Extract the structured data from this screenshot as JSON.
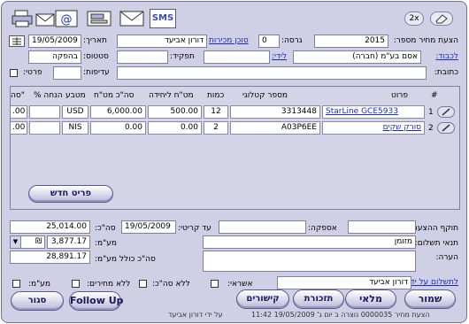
{
  "toolbar": {
    "sms_label": "SMS",
    "zoom_label": "2x"
  },
  "header": {
    "quote_number_label": "הצעת מחיר מספר:",
    "quote_number": "2015",
    "version_label": "גרסה:",
    "version": "0",
    "salesperson_label": "סוכן מכירות",
    "salesperson": "דורון אביעד",
    "date_label": "תאריך:",
    "date": "19/05/2009",
    "to_label": "לכבוד:",
    "to_value": "אסם בע\"מ (חברה)",
    "for_attention_label": "לידי:",
    "for_attention": "",
    "role_label": "תפקיד:",
    "role": "",
    "status_label": "סטטוס:",
    "status": "בהפקה",
    "address_label": "כתובת:",
    "address": "",
    "priority_label": "עדיפות:",
    "priority": "",
    "details_label": "פרטי:"
  },
  "grid": {
    "columns": [
      "#",
      "פרוט",
      "מספר קטלוגי",
      "כמות",
      "מט\"ח ליחידה",
      "סה\"כ מט\"ח",
      "מטבע",
      "% הנחה",
      "סה\""
    ],
    "rows": [
      {
        "num": "1",
        "item": "StarLine GCE5933",
        "catalog": "3313448",
        "qty": "12",
        "unit_price": "500.00",
        "total": "6,000.00",
        "currency": "USD",
        "discount": "",
        "sum": ".00"
      },
      {
        "num": "2",
        "item": "סורק שקים",
        "catalog": "A03P6EE",
        "qty": "2",
        "unit_price": "0.00",
        "total": "0.00",
        "currency": "NIS",
        "discount": "",
        "sum": ".00"
      }
    ],
    "new_item_button": "פריט חדש"
  },
  "summary": {
    "validity_label": "תוקף ההצעה:",
    "validity": "",
    "supply_label": "אספקה:",
    "supply": "",
    "until_label": "עד קריטי:",
    "until": "19/05/2009",
    "total_label": "סה\"כ:",
    "total": "25,014.00",
    "payment_terms_label": "תנאי תשלום:",
    "payment_terms": "מזומן",
    "vat_label": "מע\"מ:",
    "vat": "3,877.17",
    "vat_unit": "₪",
    "note_label": "הערה:",
    "grand_total_label": "סה\"כ כולל מע\"מ:",
    "grand_total": "28,891.17",
    "responsible_label": "לתשלום על ידי:",
    "responsible": "דורון אביעד",
    "vat_check_label": "מע\"מ:",
    "no_prices_label": "ללא מחירים:",
    "no_total_label": "ללא סה\"כ:",
    "credit_label": "אשראי:"
  },
  "buttons": {
    "save": "שמור",
    "inventory": "מלאי",
    "reminder": "תזכורת",
    "links": "קישורים",
    "follow_up": "Follow Up",
    "close": "סגור"
  },
  "footer": {
    "created": "הצעת מחיר 0000035 נוצרה ב יום ג' 19/05/2009 11:42",
    "by": "על ידי דורון אביעד"
  }
}
